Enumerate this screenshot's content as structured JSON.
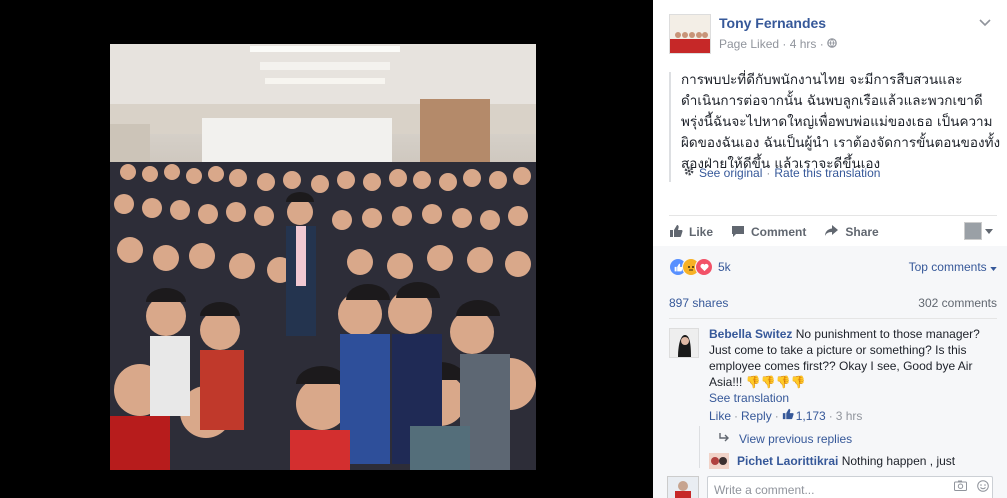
{
  "post": {
    "page_name": "Tony Fernandes",
    "status": "Page Liked",
    "time": "4 hrs",
    "text": "การพบปะที่ดีกับพนักงานไทย จะมีการสืบสวนและดำเนินการต่อจากนั้น ฉันพบลูกเรือแล้วและพวกเขาดีพรุ่งนี้ฉันจะไปหาดใหญ่เพื่อพบพ่อแม่ของเธอ เป็นความผิดของฉันเอง ฉันเป็นผู้นำ เราต้องจัดการขั้นตอนของทั้งสองฝ่ายให้ดีขึ้น แล้วเราจะดีขึ้นเอง",
    "see_original": "See original",
    "rate_translation": "Rate this translation",
    "separator": "·"
  },
  "actions": {
    "like": "Like",
    "comment": "Comment",
    "share": "Share"
  },
  "stats": {
    "reactions": "5k",
    "top_comments": "Top comments",
    "shares": "897 shares",
    "comments": "302 comments"
  },
  "comment": {
    "author": "Bebella Switez",
    "text": "No punishment to those manager? Just come to take a picture or something? Is this employee comes first?? Okay I see, Good bye Air Asia!!! 👎👎👎👎",
    "see_translation": "See translation",
    "like": "Like",
    "reply": "Reply",
    "likes": "1,173",
    "time": "3 hrs",
    "dot": "·"
  },
  "thread": {
    "view_previous": "View previous replies",
    "reply_author": "Pichet Laorittikrai",
    "reply_text": "Nothing happen , just"
  },
  "composer": {
    "placeholder": "Write a comment..."
  },
  "colors": {
    "link": "#365899",
    "muted": "#90949c",
    "panel_bg": "#f6f7f9"
  }
}
